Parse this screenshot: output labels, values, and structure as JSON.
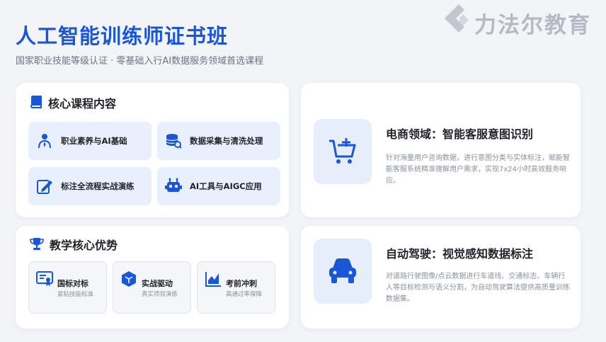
{
  "header": {
    "title": "人工智能训练师证书班",
    "subtitle": "国家职业技能等级认证 · 零基础入行AI数据服务领域首选课程"
  },
  "logo": {
    "text": "力法尔教育",
    "icon": "chevron-logo-icon"
  },
  "course": {
    "heading": "核心课程内容",
    "icon": "book-icon",
    "items": [
      {
        "label": "职业素养与AI基础",
        "icon": "person-tie-icon"
      },
      {
        "label": "数据采集与清洗处理",
        "icon": "database-search-icon"
      },
      {
        "label": "标注全流程实战演练",
        "icon": "edit-pencil-icon"
      },
      {
        "label": "AI工具与AIGC应用",
        "icon": "robot-icon"
      }
    ]
  },
  "advantages": {
    "heading": "教学核心优势",
    "icon": "trophy-icon",
    "items": [
      {
        "title": "国标对标",
        "desc": "紧贴技能标准",
        "icon": "certificate-icon"
      },
      {
        "title": "实战驱动",
        "desc": "真实项目演练",
        "icon": "cube-icon"
      },
      {
        "title": "考前冲刺",
        "desc": "高通过率保障",
        "icon": "chart-icon"
      }
    ]
  },
  "domains": [
    {
      "title": "电商领域：智能客服意图识别",
      "desc": "针对海量用户咨询数据，进行意图分类与实体标注，赋能智能客服系统精准理解用户需求，实现7x24小时高效服务响应。",
      "icon": "cart-add-icon"
    },
    {
      "title": "自动驾驶：视觉感知数据标注",
      "desc": "对道路行驶图像/点云数据进行车道线、交通标志、车辆行人等目标检测与语义分割，为自动驾驶算法提供高质量训练数据集。",
      "icon": "car-icon"
    }
  ],
  "colors": {
    "accent": "#1a56d8",
    "tile_bg": "#e8f0fd",
    "background": "#f2f4f8"
  }
}
